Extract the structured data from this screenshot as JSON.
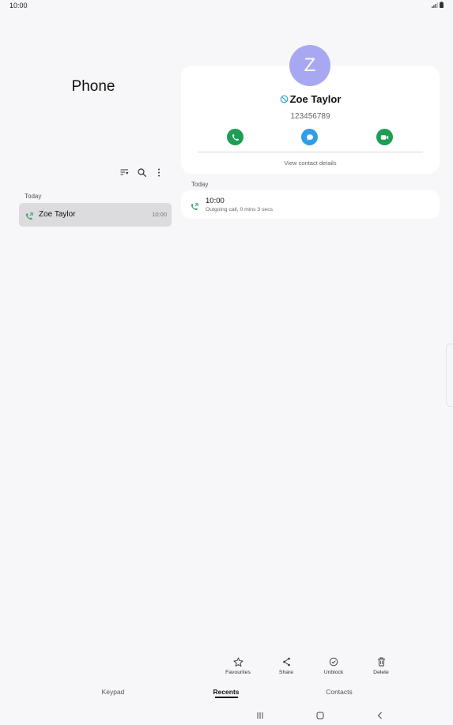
{
  "status_bar": {
    "time": "10:00"
  },
  "app": {
    "title": "Phone"
  },
  "list": {
    "section_label": "Today",
    "items": [
      {
        "name": "Zoe Taylor",
        "time": "10:00",
        "icon": "outgoing-call-icon"
      }
    ]
  },
  "contact": {
    "avatar_letter": "Z",
    "name": "Zoe Taylor",
    "number": "123456789",
    "blocked_icon": "blocked-icon",
    "view_details_label": "View contact details",
    "avatar_color": "#a8a8f2",
    "call_color": "#1e9d55",
    "message_color": "#2f9de8"
  },
  "log": {
    "section_label": "Today",
    "entries": [
      {
        "time": "10:00",
        "description": "Outgoing call, 0 mins 3 secs",
        "icon": "outgoing-call-icon"
      }
    ]
  },
  "actions": {
    "favourites": "Favourites",
    "share": "Share",
    "unblock": "Unblock",
    "delete": "Delete"
  },
  "tabs": {
    "keypad": "Keypad",
    "recents": "Recents",
    "contacts": "Contacts",
    "active": "Recents"
  }
}
